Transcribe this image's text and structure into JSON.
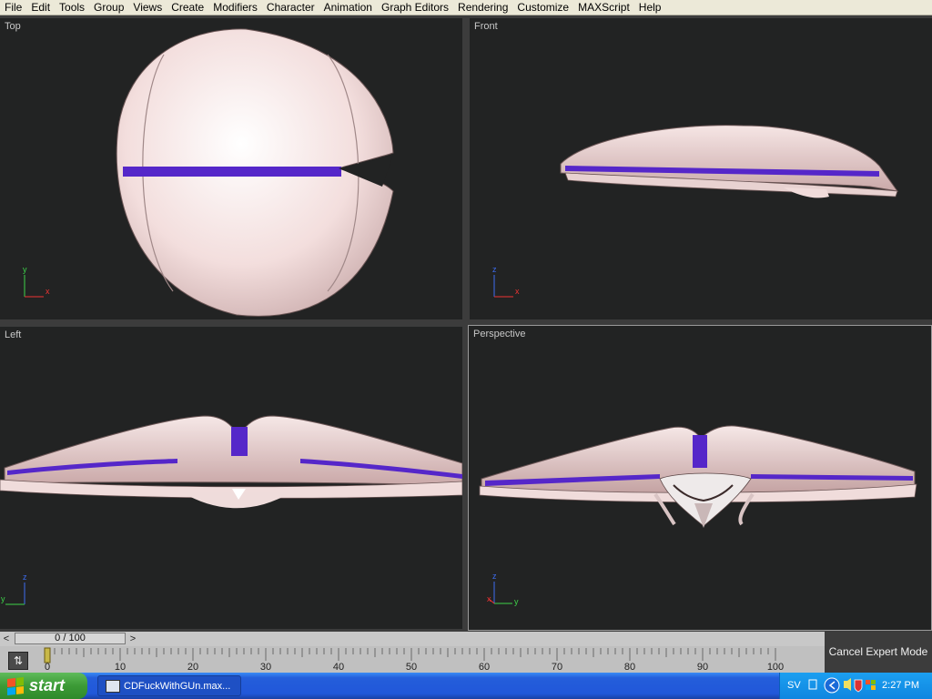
{
  "menu": [
    "File",
    "Edit",
    "Tools",
    "Group",
    "Views",
    "Create",
    "Modifiers",
    "Character",
    "Animation",
    "Graph Editors",
    "Rendering",
    "Customize",
    "MAXScript",
    "Help"
  ],
  "viewports": {
    "top": {
      "label": "Top",
      "axes": [
        "y",
        "x"
      ]
    },
    "front": {
      "label": "Front",
      "axes": [
        "z",
        "x"
      ]
    },
    "left": {
      "label": "Left",
      "axes": [
        "z",
        "y"
      ]
    },
    "perspective": {
      "label": "Perspective",
      "axes": [
        "z",
        "y",
        "x"
      ]
    }
  },
  "timeline": {
    "frame_readout": "0 / 100",
    "prev_arrow": "<",
    "next_arrow": ">",
    "ticks": [
      "0",
      "10",
      "20",
      "30",
      "40",
      "50",
      "60",
      "70",
      "80",
      "90",
      "100"
    ]
  },
  "expert_mode_label": "Cancel Expert Mode",
  "taskbar": {
    "start_label": "start",
    "task_label": "CDFuckWithGUn.max...",
    "language": "SV",
    "clock": "2:27 PM"
  },
  "colors": {
    "viewport_bg": "#222323",
    "model_skin": "#f3dedd",
    "model_stripe": "#5527c9",
    "active_border": "#9a9a9a"
  },
  "icons": {
    "set_key": "key-icon",
    "tray": [
      "network-icon",
      "audio-icon",
      "security-icon",
      "windows-flag-icon"
    ]
  }
}
